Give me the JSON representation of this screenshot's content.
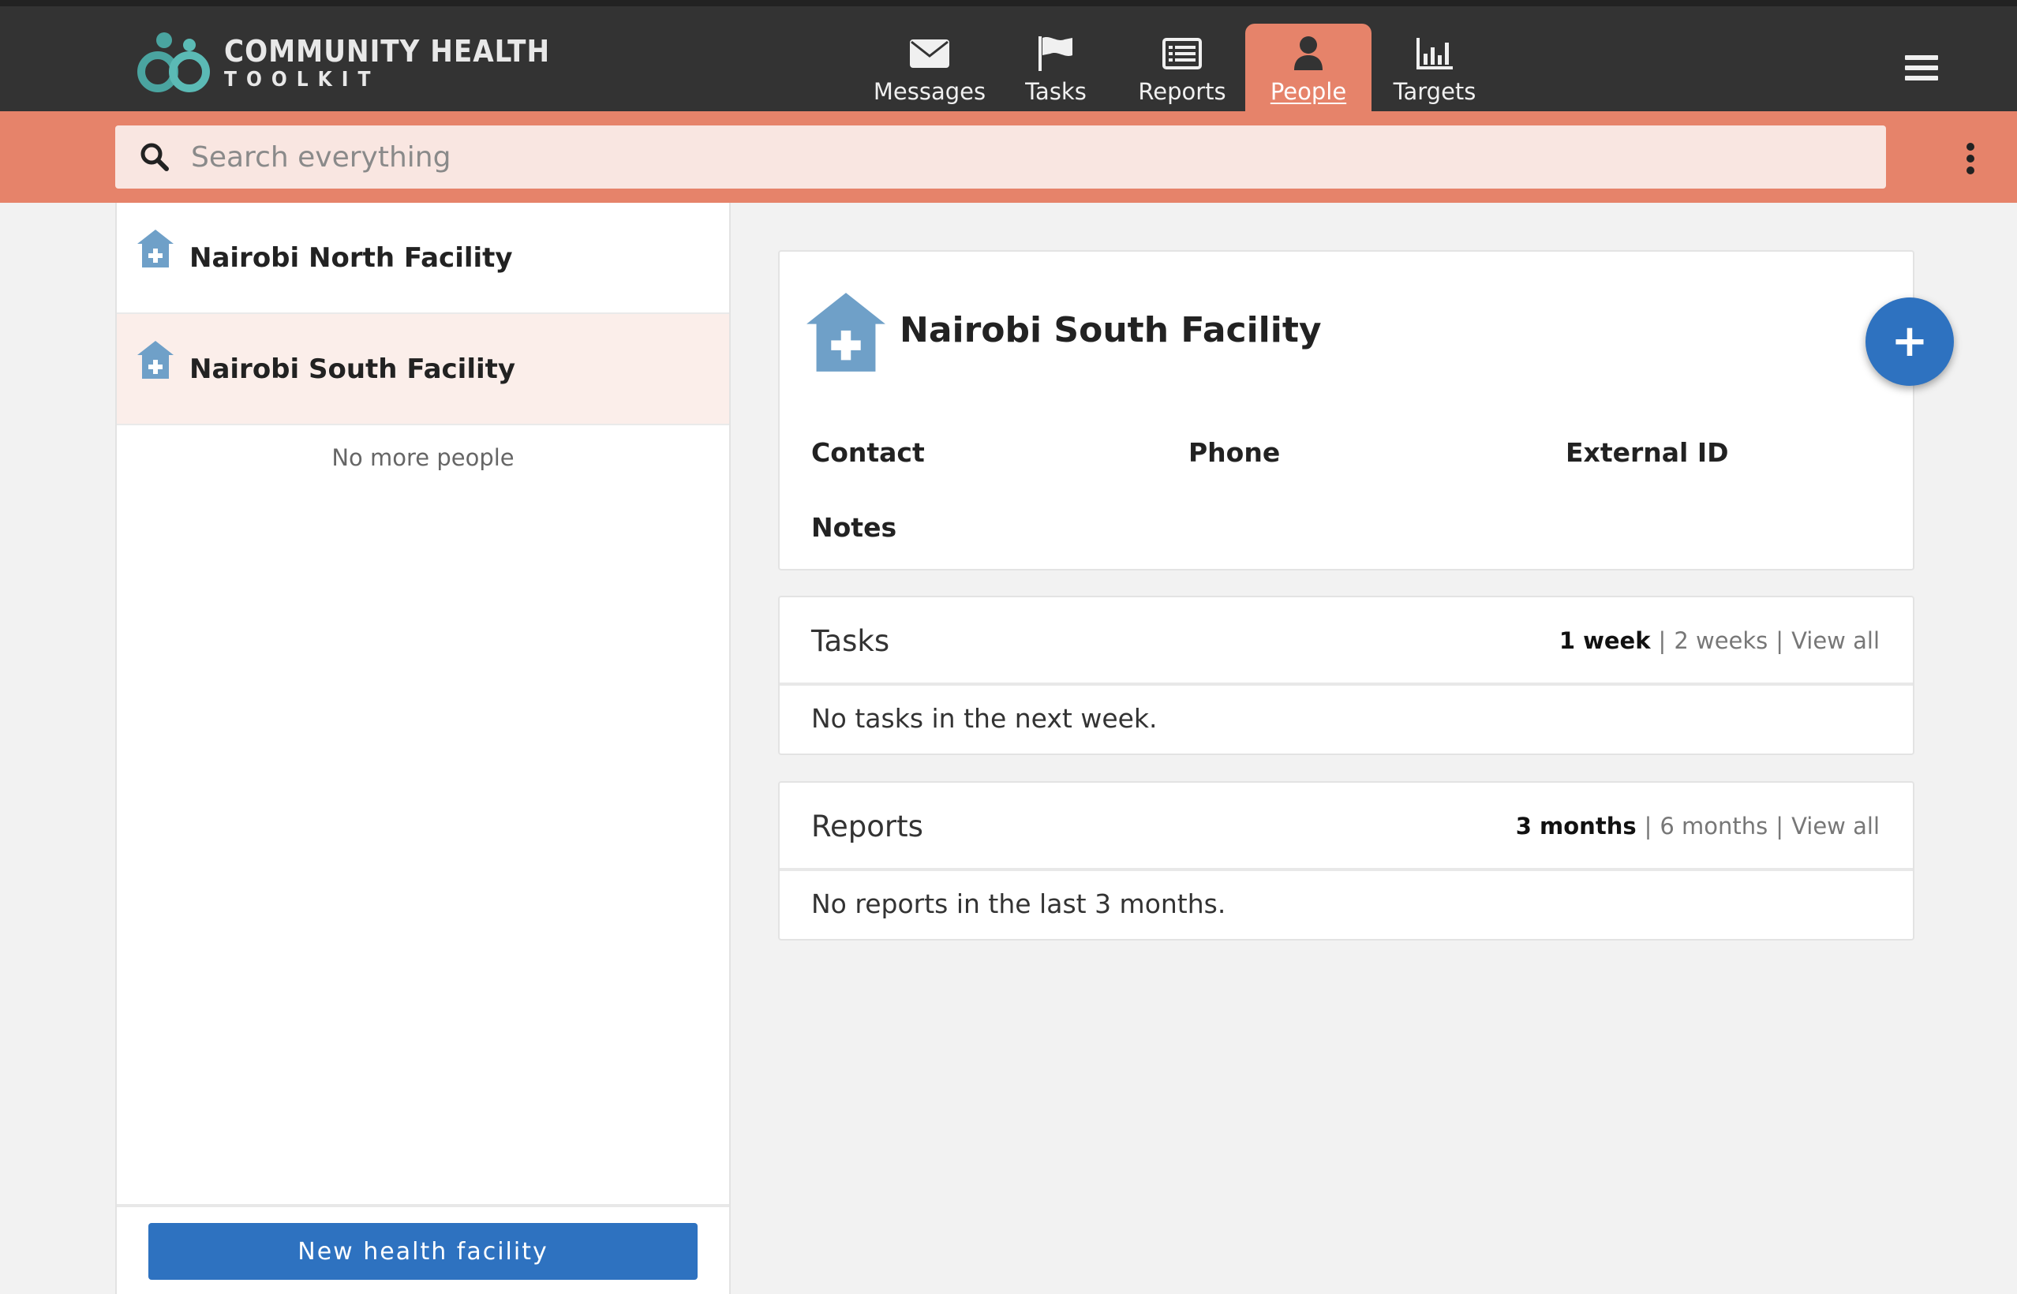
{
  "brand": {
    "line1": "COMMUNITY HEALTH",
    "line2": "TOOLKIT"
  },
  "nav": {
    "tabs": [
      {
        "label": "Messages",
        "icon": "envelope-icon"
      },
      {
        "label": "Tasks",
        "icon": "flag-icon"
      },
      {
        "label": "Reports",
        "icon": "list-icon"
      },
      {
        "label": "People",
        "icon": "person-icon",
        "active": true
      },
      {
        "label": "Targets",
        "icon": "bar-chart-icon"
      }
    ]
  },
  "search": {
    "placeholder": "Search everything"
  },
  "people_list": {
    "items": [
      {
        "name": "Nairobi North Facility",
        "icon": "health-facility-icon"
      },
      {
        "name": "Nairobi South Facility",
        "icon": "health-facility-icon",
        "selected": true
      }
    ],
    "end_message": "No more people",
    "new_button_label": "New health facility"
  },
  "detail": {
    "title": "Nairobi South Facility",
    "fields": {
      "contact": "Contact",
      "phone": "Phone",
      "external_id": "External ID",
      "notes": "Notes"
    },
    "add_button": "+"
  },
  "tasks_section": {
    "title": "Tasks",
    "filters": {
      "active": "1 week",
      "option2": "2 weeks",
      "option3": "View all"
    },
    "empty": "No tasks in the next week."
  },
  "reports_section": {
    "title": "Reports",
    "filters": {
      "active": "3 months",
      "option2": "6 months",
      "option3": "View all"
    },
    "empty": "No reports in the last 3 months."
  },
  "colors": {
    "header": "#333333",
    "accent": "#e6836a",
    "primary_button": "#2e72c0",
    "facility_icon": "#6fa0c8"
  }
}
